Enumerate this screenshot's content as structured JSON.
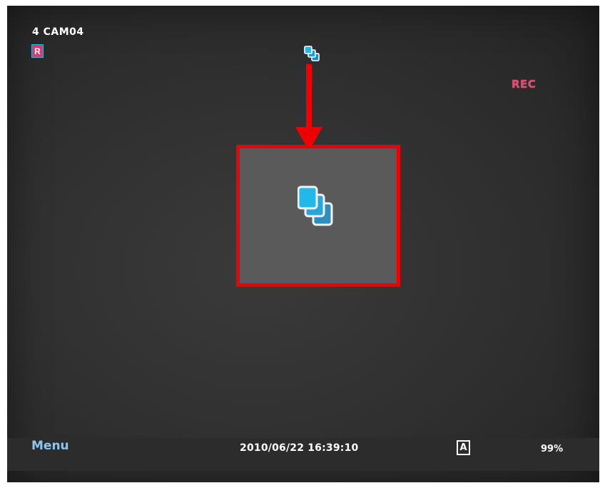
{
  "overlay": {
    "camera_label": "4 CAM04",
    "record_badge": "R",
    "rec_label": "REC"
  },
  "icons": {
    "sequence_small": "sequence-icon",
    "sequence_large": "sequence-icon",
    "arrow": "arrow-down-icon"
  },
  "status_bar": {
    "menu_label": "Menu",
    "datetime": "2010/06/22 16:39:10",
    "mode_badge": "A",
    "disk_usage": "99%"
  },
  "colors": {
    "highlight": "#ee0000",
    "rec": "#e24a72",
    "record_badge": "#d63a72",
    "icon_cyan": "#1fb8e8",
    "menu": "#8ec5f0"
  }
}
